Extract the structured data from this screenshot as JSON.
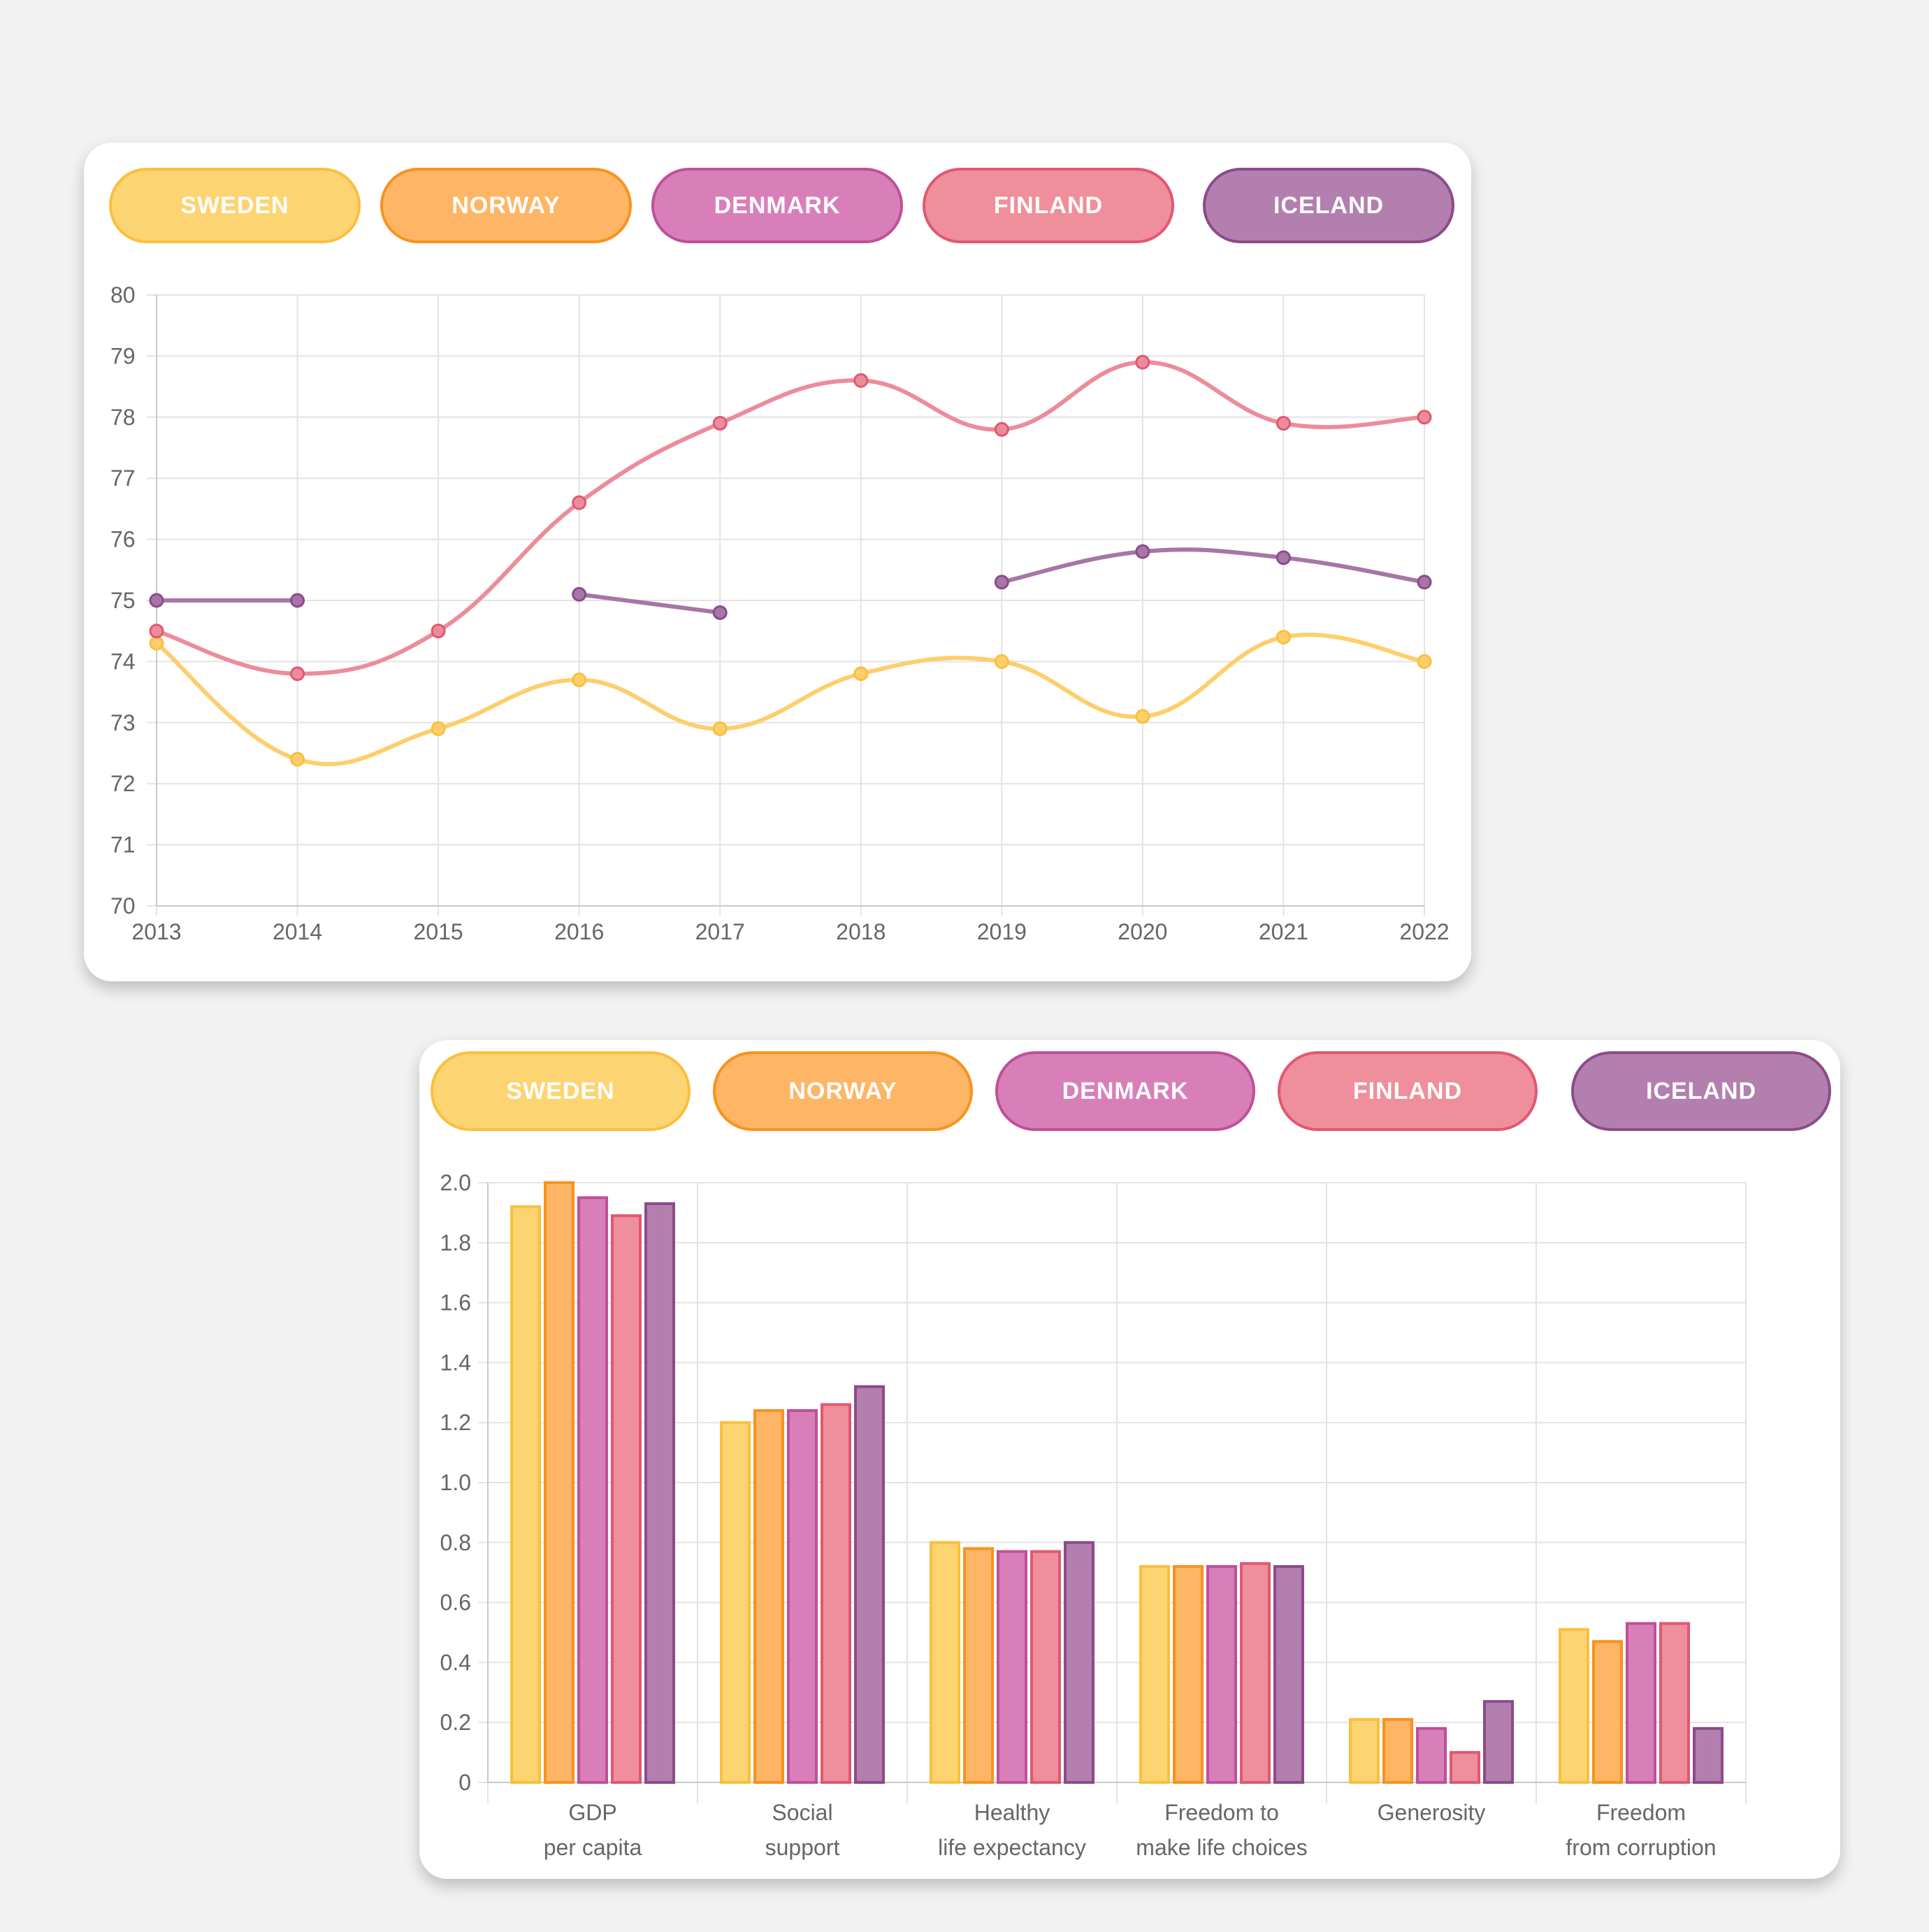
{
  "colors": {
    "sweden": {
      "fill": "#fdd472",
      "border": "#fbbf3e",
      "line": "#fdce6b"
    },
    "norway": {
      "fill": "#feb565",
      "border": "#f8921e",
      "line": "#feb565"
    },
    "denmark": {
      "fill": "#d87fba",
      "border": "#c04f99",
      "line": "#d87fba"
    },
    "finland": {
      "fill": "#ee8f9b",
      "border": "#e05872",
      "line": "#ec8c9a"
    },
    "iceland": {
      "fill": "#b27fae",
      "border": "#8c4b8a",
      "line": "#a775a6"
    }
  },
  "line_legend": [
    {
      "label": "SWEDEN",
      "key": "sweden"
    },
    {
      "label": "NORWAY",
      "key": "norway"
    },
    {
      "label": "DENMARK",
      "key": "denmark"
    },
    {
      "label": "FINLAND",
      "key": "finland"
    },
    {
      "label": "ICELAND",
      "key": "iceland"
    }
  ],
  "bar_legend": [
    {
      "label": "SWEDEN",
      "key": "sweden"
    },
    {
      "label": "NORWAY",
      "key": "norway"
    },
    {
      "label": "DENMARK",
      "key": "denmark"
    },
    {
      "label": "FINLAND",
      "key": "finland"
    },
    {
      "label": "ICELAND",
      "key": "iceland"
    }
  ],
  "chart_data": [
    {
      "type": "line",
      "title": "",
      "xlabel": "",
      "ylabel": "",
      "x": [
        "2013",
        "2014",
        "2015",
        "2016",
        "2017",
        "2018",
        "2019",
        "2020",
        "2021",
        "2022"
      ],
      "ylim": [
        70,
        80
      ],
      "yticks": [
        "70",
        "71",
        "72",
        "73",
        "74",
        "75",
        "76",
        "77",
        "78",
        "79",
        "80"
      ],
      "grid": true,
      "legend": "top",
      "series": [
        {
          "name": "SWEDEN",
          "key": "sweden",
          "values": [
            74.3,
            72.4,
            72.9,
            73.7,
            72.9,
            73.8,
            74.0,
            73.1,
            74.4,
            74.0
          ]
        },
        {
          "name": "FINLAND",
          "key": "finland",
          "values": [
            74.5,
            73.8,
            74.5,
            76.6,
            77.9,
            78.6,
            77.8,
            78.9,
            77.9,
            78.0
          ]
        },
        {
          "name": "ICELAND",
          "key": "iceland",
          "values": [
            75.0,
            75.0,
            null,
            75.1,
            74.8,
            null,
            75.3,
            75.8,
            75.7,
            75.3
          ]
        }
      ]
    },
    {
      "type": "bar",
      "title": "",
      "xlabel": "",
      "ylabel": "",
      "categories": [
        [
          "GDP",
          "per capita"
        ],
        [
          "Social",
          "support"
        ],
        [
          "Healthy",
          "life expectancy"
        ],
        [
          "Freedom to",
          "make life choices"
        ],
        [
          "Generosity"
        ],
        [
          "Freedom",
          "from corruption"
        ]
      ],
      "ylim": [
        0,
        2.0
      ],
      "yticks": [
        "0",
        "0.2",
        "0.4",
        "0.6",
        "0.8",
        "1.0",
        "1.2",
        "1.4",
        "1.6",
        "1.8",
        "2.0"
      ],
      "grid": true,
      "legend": "top",
      "series": [
        {
          "name": "SWEDEN",
          "key": "sweden",
          "values": [
            1.92,
            1.2,
            0.8,
            0.72,
            0.21,
            0.51
          ]
        },
        {
          "name": "NORWAY",
          "key": "norway",
          "values": [
            2.0,
            1.24,
            0.78,
            0.72,
            0.21,
            0.47
          ]
        },
        {
          "name": "DENMARK",
          "key": "denmark",
          "values": [
            1.95,
            1.24,
            0.77,
            0.72,
            0.18,
            0.53
          ]
        },
        {
          "name": "FINLAND",
          "key": "finland",
          "values": [
            1.89,
            1.26,
            0.77,
            0.73,
            0.1,
            0.53
          ]
        },
        {
          "name": "ICELAND",
          "key": "iceland",
          "values": [
            1.93,
            1.32,
            0.8,
            0.72,
            0.27,
            0.18
          ]
        }
      ]
    }
  ]
}
